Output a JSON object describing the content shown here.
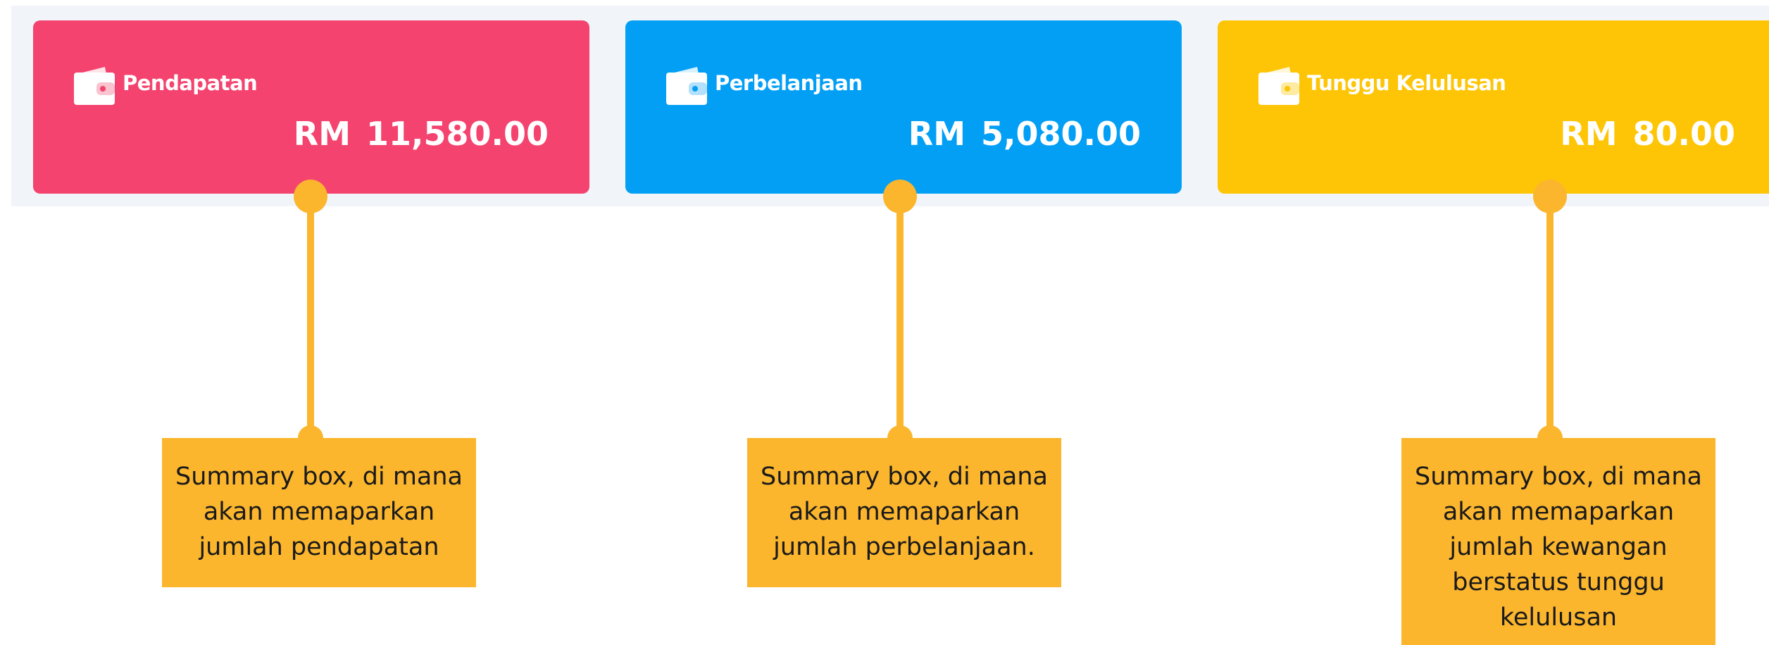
{
  "cards": [
    {
      "title": "Pendapatan",
      "currency": "RM",
      "amount": "11,580.00",
      "color": "#f4436e",
      "icon": "wallet-icon"
    },
    {
      "title": "Perbelanjaan",
      "currency": "RM",
      "amount": "5,080.00",
      "color": "#039ff5",
      "icon": "wallet-icon"
    },
    {
      "title": "Tunggu Kelulusan",
      "currency": "RM",
      "amount": "80.00",
      "color": "#fdc505",
      "icon": "wallet-icon"
    }
  ],
  "annotations": [
    {
      "lines": [
        "Summary box, di mana",
        "akan memaparkan",
        "jumlah pendapatan"
      ]
    },
    {
      "lines": [
        "Summary box, di mana",
        "akan memaparkan",
        "jumlah perbelanjaan."
      ]
    },
    {
      "lines": [
        "Summary box, di mana",
        "akan memaparkan",
        "jumlah kewangan",
        "berstatus tunggu",
        "kelulusan"
      ]
    }
  ],
  "annotation_color": "#fbb62e"
}
